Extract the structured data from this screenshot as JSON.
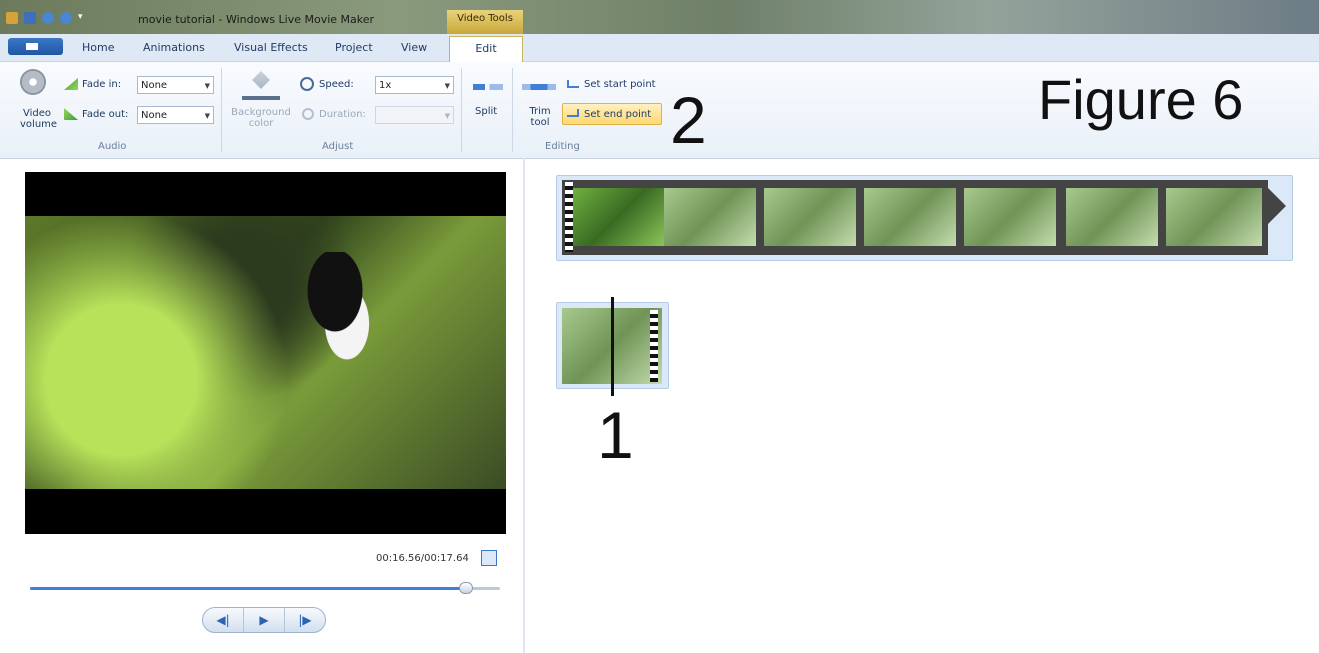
{
  "titlebar": {
    "title": "movie tutorial - Windows Live Movie Maker",
    "contextual_tab": "Video Tools"
  },
  "tabs": [
    "Home",
    "Animations",
    "Visual Effects",
    "Project",
    "View",
    "Edit"
  ],
  "active_tab": "Edit",
  "ribbon": {
    "audio": {
      "video_volume": "Video volume",
      "fade_in_label": "Fade in:",
      "fade_in_value": "None",
      "fade_out_label": "Fade out:",
      "fade_out_value": "None",
      "group": "Audio"
    },
    "adjust": {
      "background_color": "Background color",
      "speed_label": "Speed:",
      "speed_value": "1x",
      "duration_label": "Duration:",
      "duration_value": "",
      "group": "Adjust"
    },
    "editing": {
      "split": "Split",
      "trim_tool": "Trim tool",
      "set_start_point": "Set start point",
      "set_end_point": "Set end point",
      "group": "Editing"
    }
  },
  "annotations": {
    "figure": "Figure 6",
    "marker_1": "1",
    "marker_2": "2"
  },
  "preview": {
    "timecode": "00:16.56/00:17.64",
    "progress": 0.94
  },
  "colors": {
    "accent": "#3f7fd8",
    "highlight": "#ffd770",
    "ribbon_bg": "#e9f0f8"
  }
}
